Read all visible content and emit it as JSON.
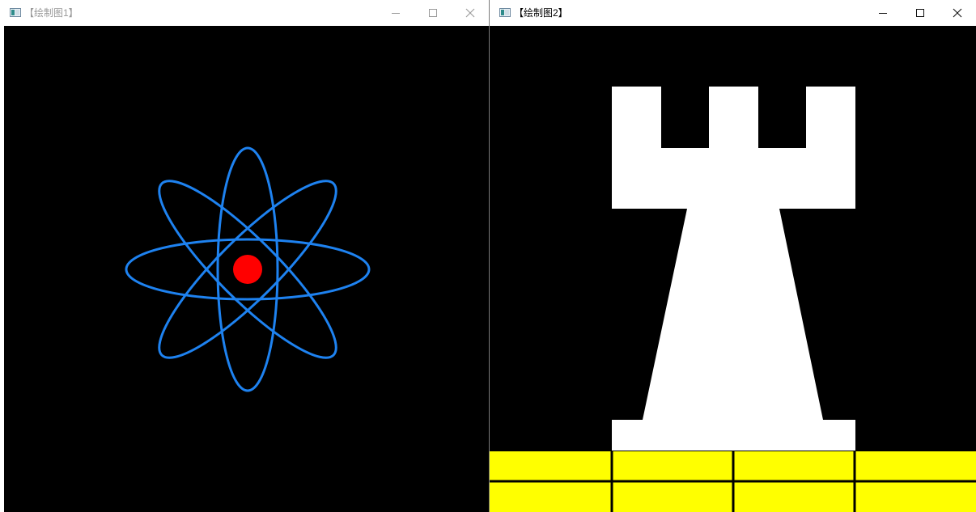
{
  "windows": [
    {
      "id": "drawing-1",
      "title": "【绘制图1】",
      "active": false,
      "canvas": {
        "background": "#000000",
        "atom": {
          "orbit_color": "#1e82f0",
          "nucleus_color": "#ff0000",
          "orbit_angles_deg": [
            0,
            45,
            90,
            -45
          ]
        }
      }
    },
    {
      "id": "drawing-2",
      "title": "【绘制图2】",
      "active": true,
      "canvas": {
        "background": "#000000",
        "rook": {
          "color": "#ffffff"
        },
        "floor": {
          "color": "#ffff00",
          "grid_line_color": "#000000"
        }
      }
    }
  ],
  "titlebar_controls": {
    "minimize_icon": "minimize-icon",
    "maximize_icon": "maximize-icon",
    "close_icon": "close-icon"
  },
  "background_window": {
    "accent_colors": [
      "#2e8b57",
      "#4b0082",
      "#1e90ff"
    ]
  }
}
